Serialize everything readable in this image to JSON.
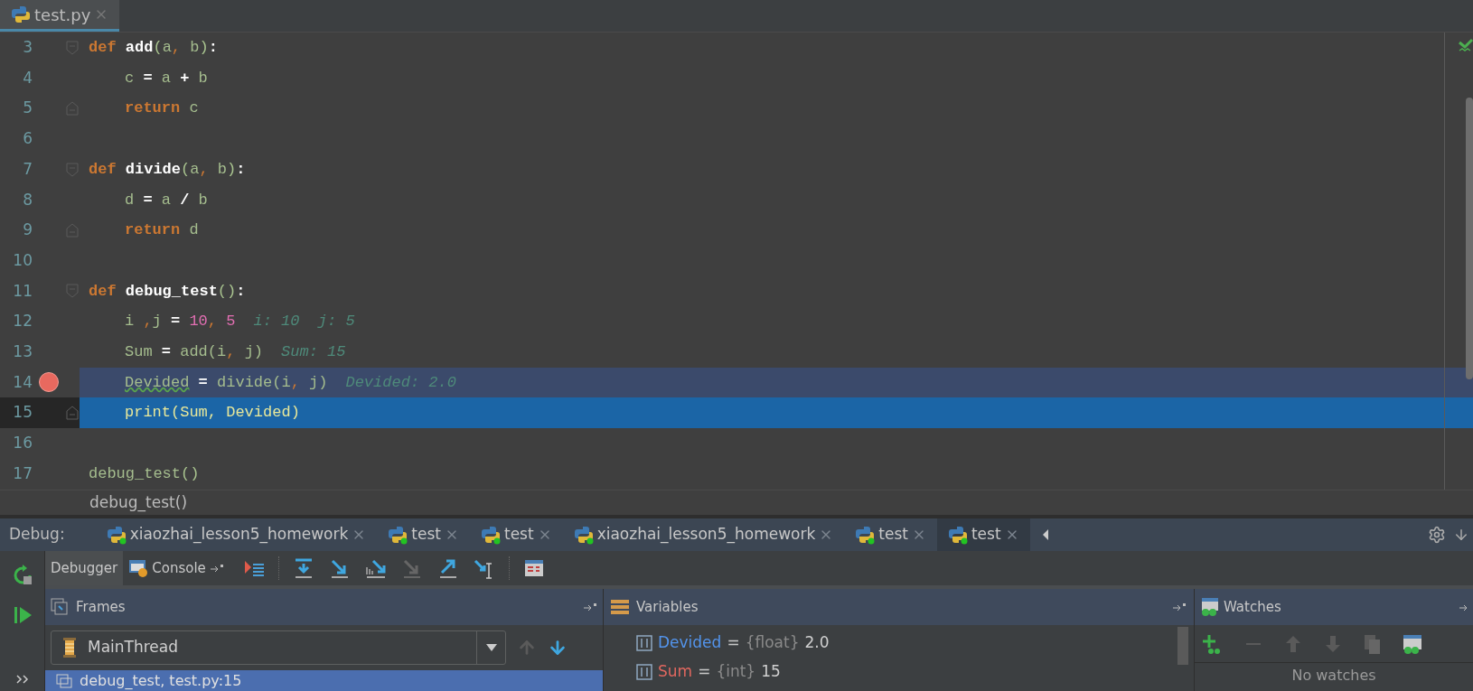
{
  "editor_tabs": [
    {
      "label": "test.py",
      "selected": true
    }
  ],
  "code_lines": [
    {
      "number": "3",
      "indented": false,
      "fold_start": true,
      "fold_end": false,
      "breakpoint": false,
      "execution_point": false,
      "tokens": [
        {
          "t": "def ",
          "kind": "kw"
        },
        {
          "t": "add",
          "kind": "fn"
        },
        {
          "t": "(",
          "kind": "paren"
        },
        {
          "t": "a",
          "kind": "id"
        },
        {
          "t": ", ",
          "kind": "punct"
        },
        {
          "t": "b",
          "kind": "id"
        },
        {
          "t": ")",
          "kind": "paren"
        },
        {
          "t": ":",
          "kind": "op"
        }
      ]
    },
    {
      "number": "4",
      "indented": true,
      "fold_start": false,
      "fold_end": false,
      "breakpoint": false,
      "execution_point": false,
      "tokens": [
        {
          "t": "c ",
          "kind": "id"
        },
        {
          "t": "=",
          "kind": "op"
        },
        {
          "t": " a ",
          "kind": "id"
        },
        {
          "t": "+",
          "kind": "op"
        },
        {
          "t": " b",
          "kind": "id"
        }
      ]
    },
    {
      "number": "5",
      "indented": true,
      "fold_start": false,
      "fold_end": true,
      "breakpoint": false,
      "execution_point": false,
      "tokens": [
        {
          "t": "return ",
          "kind": "kw"
        },
        {
          "t": "c",
          "kind": "id"
        }
      ]
    },
    {
      "number": "6",
      "fold_start": false,
      "fold_end": false,
      "breakpoint": false,
      "execution_point": false
    },
    {
      "number": "7",
      "indented": false,
      "fold_start": true,
      "fold_end": false,
      "breakpoint": false,
      "execution_point": false,
      "tokens": [
        {
          "t": "def ",
          "kind": "kw"
        },
        {
          "t": "divide",
          "kind": "fn"
        },
        {
          "t": "(",
          "kind": "paren"
        },
        {
          "t": "a",
          "kind": "id"
        },
        {
          "t": ", ",
          "kind": "punct"
        },
        {
          "t": "b",
          "kind": "id"
        },
        {
          "t": ")",
          "kind": "paren"
        },
        {
          "t": ":",
          "kind": "op"
        }
      ]
    },
    {
      "number": "8",
      "indented": true,
      "fold_start": false,
      "fold_end": false,
      "breakpoint": false,
      "execution_point": false,
      "tokens": [
        {
          "t": "d ",
          "kind": "id"
        },
        {
          "t": "=",
          "kind": "op"
        },
        {
          "t": " a ",
          "kind": "id"
        },
        {
          "t": "/",
          "kind": "op"
        },
        {
          "t": " b",
          "kind": "id"
        }
      ]
    },
    {
      "number": "9",
      "indented": true,
      "fold_start": false,
      "fold_end": true,
      "breakpoint": false,
      "execution_point": false,
      "tokens": [
        {
          "t": "return ",
          "kind": "kw"
        },
        {
          "t": "d",
          "kind": "id"
        }
      ]
    },
    {
      "number": "10",
      "fold_start": false,
      "fold_end": false,
      "breakpoint": false,
      "execution_point": false
    },
    {
      "number": "11",
      "indented": false,
      "fold_start": true,
      "fold_end": false,
      "breakpoint": false,
      "execution_point": false,
      "tokens": [
        {
          "t": "def ",
          "kind": "kw"
        },
        {
          "t": "debug_test",
          "kind": "fn"
        },
        {
          "t": "()",
          "kind": "paren"
        },
        {
          "t": ":",
          "kind": "op"
        }
      ]
    },
    {
      "number": "12",
      "indented": true,
      "fold_start": false,
      "fold_end": false,
      "breakpoint": false,
      "execution_point": false,
      "tokens": [
        {
          "t": "i ",
          "kind": "id"
        },
        {
          "t": ",",
          "kind": "punct"
        },
        {
          "t": "j ",
          "kind": "id"
        },
        {
          "t": "= ",
          "kind": "op"
        },
        {
          "t": "10",
          "kind": "num"
        },
        {
          "t": ", ",
          "kind": "punct"
        },
        {
          "t": "5",
          "kind": "num"
        }
      ],
      "hint": "i: 10  j: 5"
    },
    {
      "number": "13",
      "indented": true,
      "fold_start": false,
      "fold_end": false,
      "breakpoint": false,
      "execution_point": false,
      "tokens": [
        {
          "t": "Sum ",
          "kind": "id"
        },
        {
          "t": "=",
          "kind": "op"
        },
        {
          "t": " add(i",
          "kind": "id"
        },
        {
          "t": ", ",
          "kind": "punct"
        },
        {
          "t": "j)",
          "kind": "id"
        }
      ],
      "hint": "Sum: 15"
    },
    {
      "number": "14",
      "indented": true,
      "fold_start": false,
      "fold_end": false,
      "breakpoint": true,
      "execution_point": false,
      "tokens": [
        {
          "t": "Devided",
          "kind": "warn"
        },
        {
          "t": " = ",
          "kind": "op"
        },
        {
          "t": "divide(i",
          "kind": "id"
        },
        {
          "t": ", ",
          "kind": "punct"
        },
        {
          "t": "j)",
          "kind": "id"
        }
      ],
      "hint": "Devided: 2.0"
    },
    {
      "number": "15",
      "indented": true,
      "fold_start": false,
      "fold_end": true,
      "breakpoint": false,
      "execution_point": true,
      "tokens": [
        {
          "t": "print(Sum, Devided)",
          "kind": "call"
        }
      ]
    },
    {
      "number": "16",
      "fold_start": false,
      "fold_end": false,
      "breakpoint": false,
      "execution_point": false
    },
    {
      "number": "17",
      "indented": false,
      "fold_start": false,
      "fold_end": false,
      "breakpoint": false,
      "execution_point": false,
      "tokens": [
        {
          "t": "debug_test",
          "kind": "id"
        },
        {
          "t": "()",
          "kind": "paren"
        }
      ]
    }
  ],
  "breadcrumb": "debug_test()",
  "debug_label": "Debug:",
  "sessions": [
    {
      "label": "xiaozhai_lesson5_homework",
      "selected": false
    },
    {
      "label": "test",
      "selected": false
    },
    {
      "label": "test",
      "selected": false
    },
    {
      "label": "xiaozhai_lesson5_homework",
      "selected": false
    },
    {
      "label": "test",
      "selected": false
    },
    {
      "label": "test",
      "selected": true
    }
  ],
  "view_tabs": [
    {
      "label": "Debugger",
      "selected": true
    },
    {
      "label": "Console",
      "selected": false
    }
  ],
  "frames": {
    "title": "Frames",
    "thread": "MainThread",
    "items": [
      {
        "label": "debug_test, test.py:15",
        "selected": true
      }
    ]
  },
  "variables": {
    "title": "Variables",
    "items": [
      {
        "name": "Devided",
        "separator": "=",
        "type": "{float}",
        "value": "2.0",
        "color": "#5394ec"
      },
      {
        "name": "Sum",
        "separator": "=",
        "type": "{int}",
        "value": "15",
        "color": "#e0675f"
      }
    ]
  },
  "watches": {
    "title": "Watches",
    "empty_text": "No watches"
  }
}
